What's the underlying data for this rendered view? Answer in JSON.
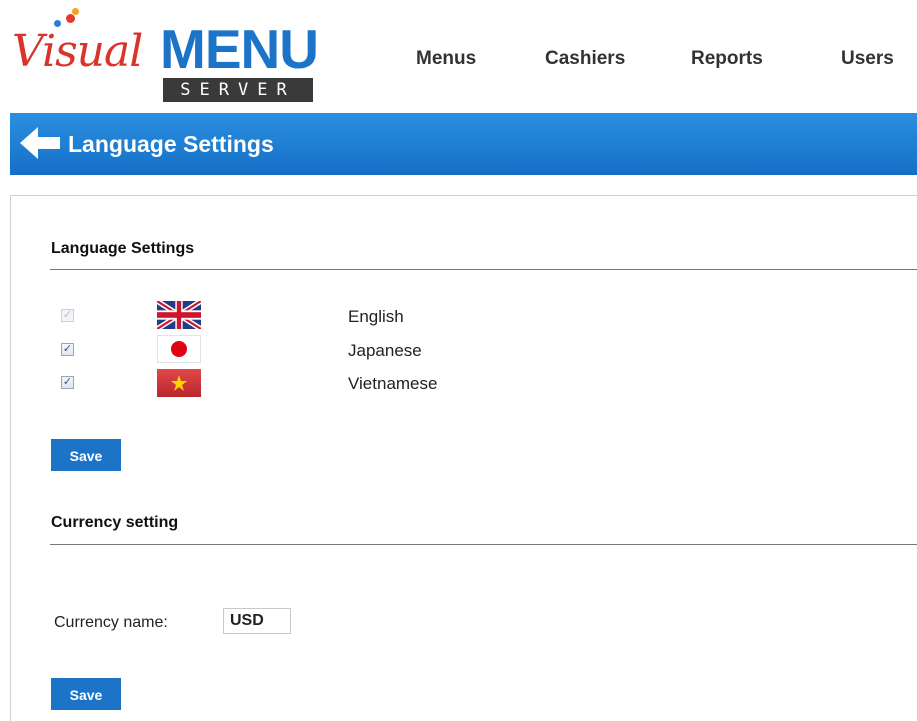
{
  "logo": {
    "word1": "Visual",
    "word2": "MENU",
    "word3": "SERVER"
  },
  "nav": {
    "items": [
      "Menus",
      "Cashiers",
      "Reports",
      "Users"
    ]
  },
  "titlebar": {
    "back_icon": "arrow-left-icon",
    "title": "Language Settings"
  },
  "language_section": {
    "heading": "Language Settings",
    "languages": [
      {
        "name": "English",
        "flag": "uk-flag-icon",
        "checked": true,
        "disabled": true
      },
      {
        "name": "Japanese",
        "flag": "japan-flag-icon",
        "checked": true,
        "disabled": false
      },
      {
        "name": "Vietnamese",
        "flag": "vietnam-flag-icon",
        "checked": true,
        "disabled": false
      }
    ],
    "save_label": "Save"
  },
  "currency_section": {
    "heading": "Currency setting",
    "field_label": "Currency name:",
    "field_value": "USD",
    "save_label": "Save"
  },
  "colors": {
    "brand_blue": "#1b74c8",
    "brand_red": "#d8342b"
  }
}
